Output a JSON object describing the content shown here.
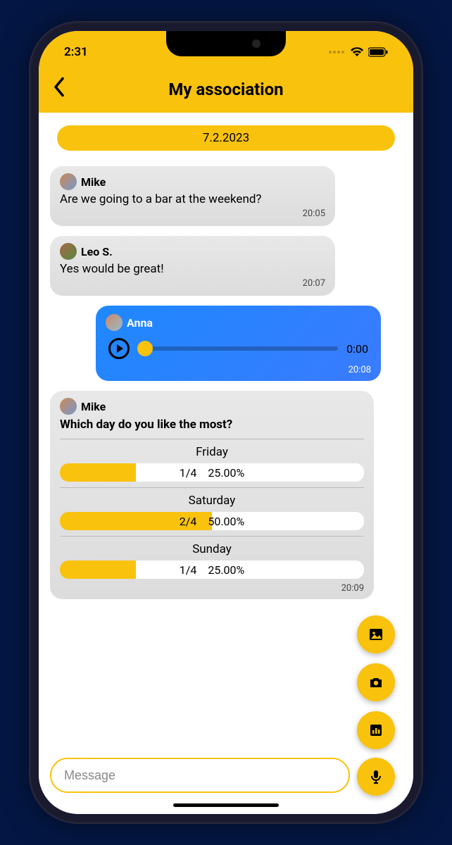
{
  "status": {
    "time": "2:31"
  },
  "header": {
    "title": "My association"
  },
  "date_pill": "7.2.2023",
  "messages": {
    "m1": {
      "sender": "Mike",
      "text": "Are we going to a bar at the weekend?",
      "time": "20:05"
    },
    "m2": {
      "sender": "Leo S.",
      "text": "Yes would be great!",
      "time": "20:07"
    },
    "m3": {
      "sender": "Anna",
      "audio_time": "0:00",
      "time": "20:08"
    },
    "m4": {
      "sender": "Mike",
      "question": "Which day do you like the most?",
      "time": "20:09",
      "options": {
        "o1": {
          "label": "Friday",
          "count": "1/4",
          "pct": "25.00%",
          "fill": 25
        },
        "o2": {
          "label": "Saturday",
          "count": "2/4",
          "pct": "50.00%",
          "fill": 50
        },
        "o3": {
          "label": "Sunday",
          "count": "1/4",
          "pct": "25.00%",
          "fill": 25
        }
      }
    }
  },
  "input": {
    "placeholder": "Message"
  }
}
